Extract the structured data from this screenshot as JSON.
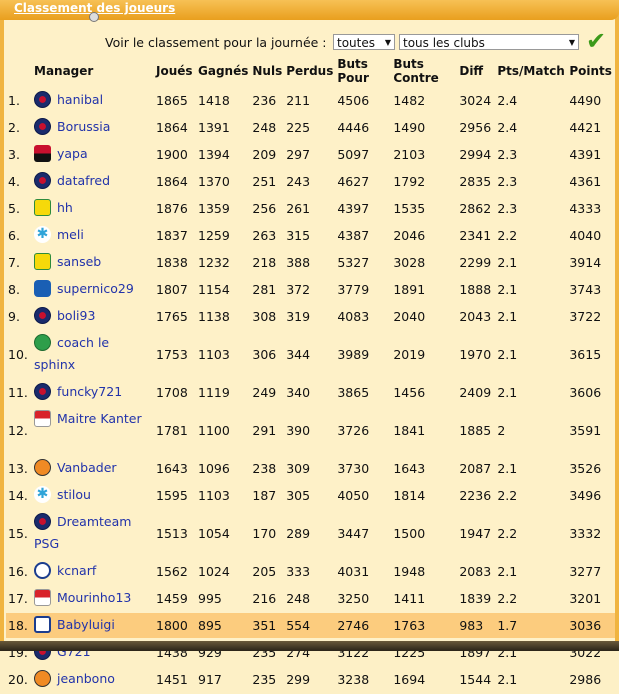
{
  "header": {
    "title": "Classement des joueurs"
  },
  "filters": {
    "label": "Voir le classement pour la journée :",
    "round_value": "toutes",
    "club_value": "tous les clubs",
    "submit_icon": "check-icon"
  },
  "columns": [
    "",
    "Manager",
    "Joués",
    "Gagnés",
    "Nuls",
    "Perdus",
    "Buts Pour",
    "Buts Contre",
    "Diff",
    "Pts/Match",
    "Points"
  ],
  "rows": [
    {
      "rank": "1.",
      "club": "psg",
      "manager": "hanibal",
      "played": "1865",
      "won": "1418",
      "draw": "236",
      "lost": "211",
      "gf": "4506",
      "ga": "1482",
      "diff": "3024",
      "ppm": "2.4",
      "points": "4490"
    },
    {
      "rank": "2.",
      "club": "psg",
      "manager": "Borussia",
      "played": "1864",
      "won": "1391",
      "draw": "248",
      "lost": "225",
      "gf": "4446",
      "ga": "1490",
      "diff": "2956",
      "ppm": "2.4",
      "points": "4421"
    },
    {
      "rank": "3.",
      "club": "nice",
      "manager": "yapa",
      "played": "1900",
      "won": "1394",
      "draw": "209",
      "lost": "297",
      "gf": "5097",
      "ga": "2103",
      "diff": "2994",
      "ppm": "2.3",
      "points": "4391"
    },
    {
      "rank": "4.",
      "club": "psg",
      "manager": "datafred",
      "played": "1864",
      "won": "1370",
      "draw": "251",
      "lost": "243",
      "gf": "4627",
      "ga": "1792",
      "diff": "2835",
      "ppm": "2.3",
      "points": "4361"
    },
    {
      "rank": "5.",
      "club": "nantes",
      "manager": "hh",
      "played": "1876",
      "won": "1359",
      "draw": "256",
      "lost": "261",
      "gf": "4397",
      "ga": "1535",
      "diff": "2862",
      "ppm": "2.3",
      "points": "4333"
    },
    {
      "rank": "6.",
      "club": "om",
      "manager": "meli",
      "played": "1837",
      "won": "1259",
      "draw": "263",
      "lost": "315",
      "gf": "4387",
      "ga": "2046",
      "diff": "2341",
      "ppm": "2.2",
      "points": "4040"
    },
    {
      "rank": "7.",
      "club": "nantes",
      "manager": "sanseb",
      "played": "1838",
      "won": "1232",
      "draw": "218",
      "lost": "388",
      "gf": "5327",
      "ga": "3028",
      "diff": "2299",
      "ppm": "2.1",
      "points": "3914"
    },
    {
      "rank": "8.",
      "club": "bastia",
      "manager": "supernico29",
      "played": "1807",
      "won": "1154",
      "draw": "281",
      "lost": "372",
      "gf": "3779",
      "ga": "1891",
      "diff": "1888",
      "ppm": "2.1",
      "points": "3743"
    },
    {
      "rank": "9.",
      "club": "psg",
      "manager": "boli93",
      "played": "1765",
      "won": "1138",
      "draw": "308",
      "lost": "319",
      "gf": "4083",
      "ga": "2040",
      "diff": "2043",
      "ppm": "2.1",
      "points": "3722"
    },
    {
      "rank": "10.",
      "club": "stetienne",
      "manager": "coach le sphinx",
      "played": "1753",
      "won": "1103",
      "draw": "306",
      "lost": "344",
      "gf": "3989",
      "ga": "2019",
      "diff": "1970",
      "ppm": "2.1",
      "points": "3615"
    },
    {
      "rank": "11.",
      "club": "psg",
      "manager": "funcky721",
      "played": "1708",
      "won": "1119",
      "draw": "249",
      "lost": "340",
      "gf": "3865",
      "ga": "1456",
      "diff": "2409",
      "ppm": "2.1",
      "points": "3606"
    },
    {
      "rank": "12.",
      "club": "monaco",
      "manager": "Maitre Kanter",
      "played": "1781",
      "won": "1100",
      "draw": "291",
      "lost": "390",
      "gf": "3726",
      "ga": "1841",
      "diff": "1885",
      "ppm": "2",
      "points": "3591"
    },
    {
      "rank": "13.",
      "club": "lorient",
      "manager": "Vanbader",
      "played": "1643",
      "won": "1096",
      "draw": "238",
      "lost": "309",
      "gf": "3730",
      "ga": "1643",
      "diff": "2087",
      "ppm": "2.1",
      "points": "3526"
    },
    {
      "rank": "14.",
      "club": "om",
      "manager": "stilou",
      "played": "1595",
      "won": "1103",
      "draw": "187",
      "lost": "305",
      "gf": "4050",
      "ga": "1814",
      "diff": "2236",
      "ppm": "2.2",
      "points": "3496"
    },
    {
      "rank": "15.",
      "club": "psg",
      "manager": "Dreamteam PSG",
      "played": "1513",
      "won": "1054",
      "draw": "170",
      "lost": "289",
      "gf": "3447",
      "ga": "1500",
      "diff": "1947",
      "ppm": "2.2",
      "points": "3332"
    },
    {
      "rank": "16.",
      "club": "montpellier",
      "manager": "kcnarf",
      "played": "1562",
      "won": "1024",
      "draw": "205",
      "lost": "333",
      "gf": "4031",
      "ga": "1948",
      "diff": "2083",
      "ppm": "2.1",
      "points": "3277"
    },
    {
      "rank": "17.",
      "club": "monaco",
      "manager": "Mourinho13",
      "played": "1459",
      "won": "995",
      "draw": "216",
      "lost": "248",
      "gf": "3250",
      "ga": "1411",
      "diff": "1839",
      "ppm": "2.2",
      "points": "3201"
    },
    {
      "rank": "18.",
      "club": "lyon",
      "manager": "Babyluigi",
      "played": "1800",
      "won": "895",
      "draw": "351",
      "lost": "554",
      "gf": "2746",
      "ga": "1763",
      "diff": "983",
      "ppm": "1.7",
      "points": "3036",
      "highlight": true
    },
    {
      "rank": "19.",
      "club": "psg",
      "manager": "G721",
      "played": "1438",
      "won": "929",
      "draw": "235",
      "lost": "274",
      "gf": "3122",
      "ga": "1225",
      "diff": "1897",
      "ppm": "2.1",
      "points": "3022"
    },
    {
      "rank": "20.",
      "club": "lorient",
      "manager": "jeanbono",
      "played": "1451",
      "won": "917",
      "draw": "235",
      "lost": "299",
      "gf": "3238",
      "ga": "1694",
      "diff": "1544",
      "ppm": "2.1",
      "points": "2986"
    }
  ]
}
